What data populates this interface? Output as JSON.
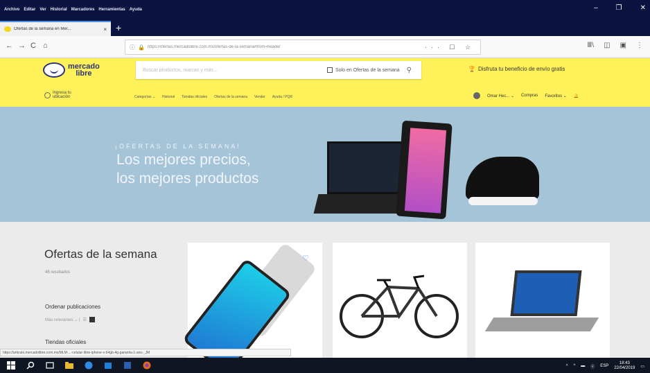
{
  "window": {
    "menu": [
      "Archivo",
      "Editar",
      "Ver",
      "Historial",
      "Marcadores",
      "Herramientas",
      "Ayuda"
    ],
    "controls": [
      "–",
      "❐",
      "✕"
    ]
  },
  "tab": {
    "title": "Ofertas de la semana en Mer...",
    "close": "×",
    "new_tab": "+"
  },
  "nav": {
    "back": "←",
    "forward": "→",
    "reload": "C",
    "home": "⌂",
    "url": "https://ofertas.mercadolibre.com.mx/ofertas-de-la-semana#from=header",
    "url_actions": "··· ☐ ☆",
    "right_icons": [
      "Ⅲ\\",
      "◫",
      "▣",
      "⋮"
    ]
  },
  "ml": {
    "logo_line1": "mercado",
    "logo_line2": "libre",
    "search_placeholder": "Buscar productos, marcas y más…",
    "search_check_label": "Solo en Ofertas de la semana",
    "promo": "Disfruta tu beneficio de envío gratis",
    "location_line1": "Ingresa tu",
    "location_line2": "ubicación",
    "nav": [
      "Categorías ⌄",
      "Historial",
      "Tiendas oficiales",
      "Ofertas de la semana",
      "Vender",
      "Ayuda / PQR"
    ],
    "user": "Omar Hec... ⌄",
    "purchases": "Compras",
    "favorites": "Favoritos ⌄",
    "bell": "🔔"
  },
  "banner": {
    "kicker": "¡OFERTAS DE LA SEMANA!",
    "line1": "Los mejores precios,",
    "line2": "los mejores productos"
  },
  "sidebar": {
    "title": "Ofertas de la semana",
    "results": "48 resultados",
    "sort_label": "Ordenar publicaciones",
    "sort_value": "Más relevantes ⌄ |",
    "stores_label": "Tiendas oficiales"
  },
  "cards": {
    "heart": "♡"
  },
  "status": {
    "link": "https://articulo.mercadolibre.com.mx/MLM-...-celular-libre-iphone-x-64gb-4g-garantia-1-ano-_JM"
  },
  "tray": {
    "items": [
      "ᴬ",
      "^",
      "▬",
      "ⓔ",
      "ESP"
    ],
    "time": "18:43",
    "date": "22/04/2019"
  },
  "colors": {
    "ml_yellow": "#fff159",
    "ml_blue": "#2d3277",
    "banner_bg": "#a5c4d8",
    "taskbar": "#101522"
  }
}
